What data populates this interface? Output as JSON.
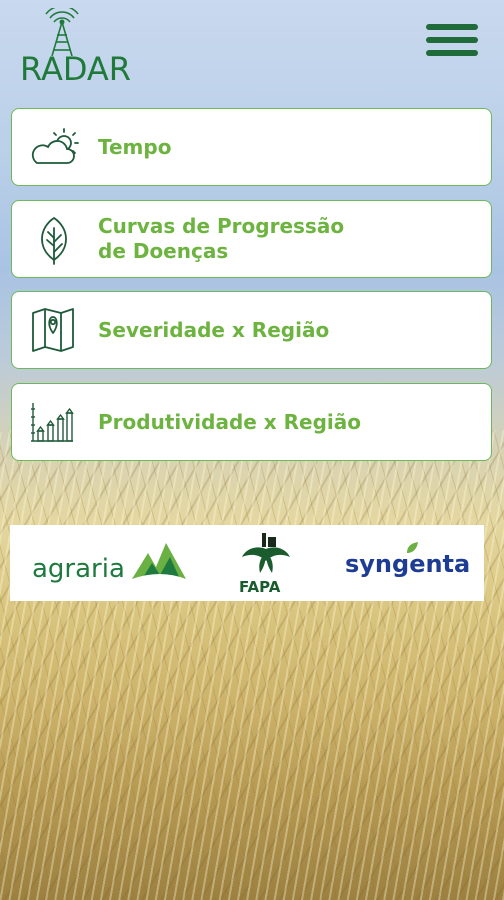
{
  "header": {
    "logo_text": "RADAR",
    "menu_icon": "hamburger-menu-icon"
  },
  "menu": [
    {
      "label": "Tempo",
      "icon": "weather-icon"
    },
    {
      "label": "Curvas de Progressão",
      "label_line2": "de Doenças",
      "icon": "leaf-icon"
    },
    {
      "label": "Severidade x Região",
      "icon": "map-icon"
    },
    {
      "label": "Produtividade x Região",
      "icon": "bar-chart-icon"
    }
  ],
  "sponsors": {
    "agraria": "agraria",
    "fapa": "FAPA",
    "syngenta": "syngenta"
  },
  "colors": {
    "brand_green": "#1f7a3a",
    "label_green": "#6db33f",
    "syngenta_blue": "#1d3d94"
  }
}
